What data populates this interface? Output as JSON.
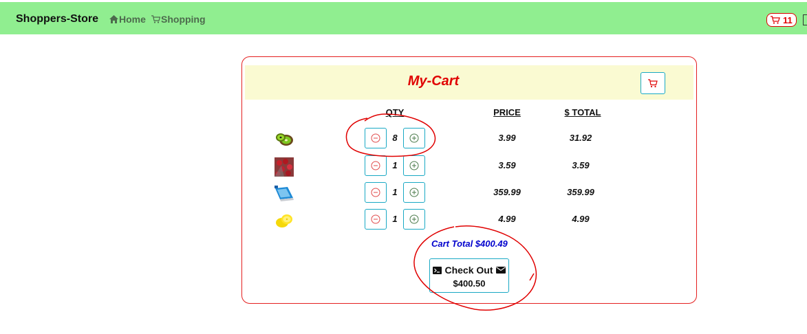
{
  "navbar": {
    "brand": "Shoppers-Store",
    "links": [
      {
        "label": "Home",
        "icon": "home-icon"
      },
      {
        "label": "Shopping",
        "icon": "shopping-cart-icon"
      }
    ],
    "cart_count": "11",
    "bg_color": "#90ee90"
  },
  "cart": {
    "title": "My-Cart",
    "columns": {
      "qty": "QTY",
      "price": "PRICE",
      "total": "$ TOTAL"
    },
    "items": [
      {
        "image": "kiwi",
        "qty": "8",
        "price": "3.99",
        "total": "31.92"
      },
      {
        "image": "berries",
        "qty": "1",
        "price": "3.59",
        "total": "3.59"
      },
      {
        "image": "laptop",
        "qty": "1",
        "price": "359.99",
        "total": "359.99"
      },
      {
        "image": "lemon",
        "qty": "1",
        "price": "4.99",
        "total": "4.99"
      }
    ],
    "cart_total": "Cart Total $400.49",
    "checkout": {
      "label": "Check Out",
      "amount": "$400.50"
    }
  },
  "colors": {
    "accent_red": "#e00000",
    "button_border": "#18a8c4",
    "total_blue": "#0000cd",
    "header_bg": "#fafad2"
  }
}
